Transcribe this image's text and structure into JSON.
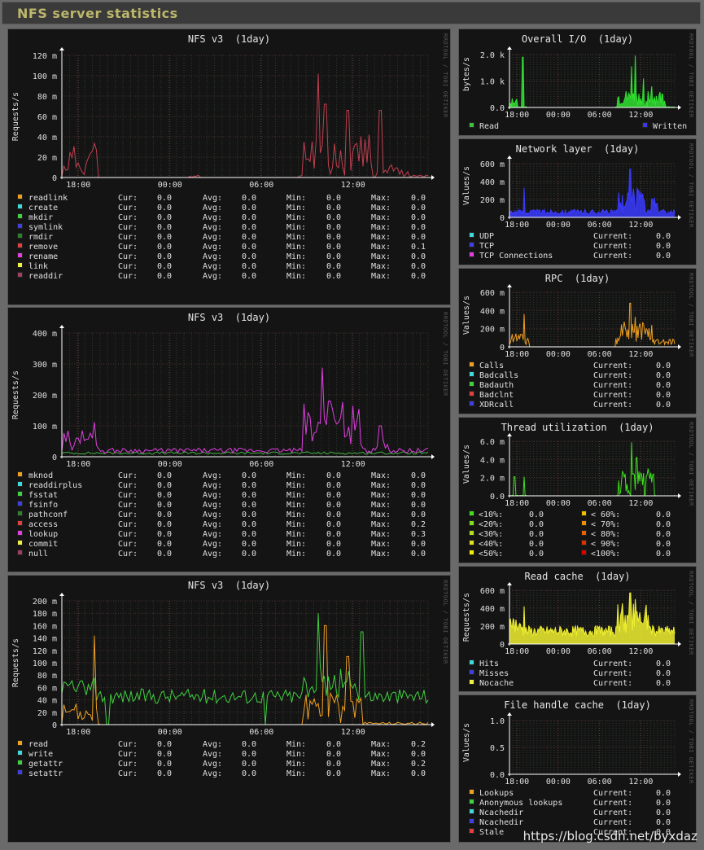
{
  "header": {
    "title": "NFS server statistics"
  },
  "watermark": "https://blog.csdn.net/byxdaz",
  "side_label": "RRDTOOL / TOBI OETIKER",
  "stat_labels": {
    "cur": "Cur:",
    "avg": "Avg:",
    "min": "Min:",
    "max": "Max:",
    "current": "Current:"
  },
  "panels": [
    {
      "id": "nfs1",
      "title": "NFS v3  (1day)",
      "ylabel": "Requests/s",
      "yticks": [
        "120 m",
        "100 m",
        "80 m",
        "60 m",
        "40 m",
        "20 m",
        "0"
      ],
      "xticks": [
        "18:00",
        "00:00",
        "06:00",
        "12:00"
      ],
      "legend": [
        {
          "name": "readlink",
          "color": "#f0a020",
          "cur": "0.0",
          "avg": "0.0",
          "min": "0.0",
          "max": "0.0"
        },
        {
          "name": "create",
          "color": "#40d8d8",
          "cur": "0.0",
          "avg": "0.0",
          "min": "0.0",
          "max": "0.0"
        },
        {
          "name": "mkdir",
          "color": "#40d040",
          "cur": "0.0",
          "avg": "0.0",
          "min": "0.0",
          "max": "0.0"
        },
        {
          "name": "symlink",
          "color": "#4040e0",
          "cur": "0.0",
          "avg": "0.0",
          "min": "0.0",
          "max": "0.0"
        },
        {
          "name": "rmdir",
          "color": "#308030",
          "cur": "0.0",
          "avg": "0.0",
          "min": "0.0",
          "max": "0.0"
        },
        {
          "name": "remove",
          "color": "#e04040",
          "cur": "0.0",
          "avg": "0.0",
          "min": "0.0",
          "max": "0.1"
        },
        {
          "name": "rename",
          "color": "#e040e0",
          "cur": "0.0",
          "avg": "0.0",
          "min": "0.0",
          "max": "0.0"
        },
        {
          "name": "link",
          "color": "#f0f040",
          "cur": "0.0",
          "avg": "0.0",
          "min": "0.0",
          "max": "0.0"
        },
        {
          "name": "readdir",
          "color": "#a04060",
          "cur": "0.0",
          "avg": "0.0",
          "min": "0.0",
          "max": "0.0"
        }
      ]
    },
    {
      "id": "nfs2",
      "title": "NFS v3  (1day)",
      "ylabel": "Requests/s",
      "yticks": [
        "400 m",
        "300 m",
        "200 m",
        "100 m",
        "0"
      ],
      "xticks": [
        "18:00",
        "00:00",
        "06:00",
        "12:00"
      ],
      "legend": [
        {
          "name": "mknod",
          "color": "#f0a020",
          "cur": "0.0",
          "avg": "0.0",
          "min": "0.0",
          "max": "0.0"
        },
        {
          "name": "readdirplus",
          "color": "#40d8d8",
          "cur": "0.0",
          "avg": "0.0",
          "min": "0.0",
          "max": "0.0"
        },
        {
          "name": "fsstat",
          "color": "#40d040",
          "cur": "0.0",
          "avg": "0.0",
          "min": "0.0",
          "max": "0.0"
        },
        {
          "name": "fsinfo",
          "color": "#4040e0",
          "cur": "0.0",
          "avg": "0.0",
          "min": "0.0",
          "max": "0.0"
        },
        {
          "name": "pathconf",
          "color": "#308030",
          "cur": "0.0",
          "avg": "0.0",
          "min": "0.0",
          "max": "0.0"
        },
        {
          "name": "access",
          "color": "#e04040",
          "cur": "0.0",
          "avg": "0.0",
          "min": "0.0",
          "max": "0.2"
        },
        {
          "name": "lookup",
          "color": "#e040e0",
          "cur": "0.0",
          "avg": "0.0",
          "min": "0.0",
          "max": "0.3"
        },
        {
          "name": "commit",
          "color": "#f0f040",
          "cur": "0.0",
          "avg": "0.0",
          "min": "0.0",
          "max": "0.0"
        },
        {
          "name": "null",
          "color": "#a04060",
          "cur": "0.0",
          "avg": "0.0",
          "min": "0.0",
          "max": "0.0"
        }
      ]
    },
    {
      "id": "nfs3",
      "title": "NFS v3  (1day)",
      "ylabel": "Requests/s",
      "yticks": [
        "200 m",
        "180 m",
        "160 m",
        "140 m",
        "120 m",
        "100 m",
        "80 m",
        "60 m",
        "40 m",
        "20 m",
        "0"
      ],
      "xticks": [
        "18:00",
        "00:00",
        "06:00",
        "12:00"
      ],
      "legend": [
        {
          "name": "read",
          "color": "#f0a020",
          "cur": "0.0",
          "avg": "0.0",
          "min": "0.0",
          "max": "0.2"
        },
        {
          "name": "write",
          "color": "#40d8d8",
          "cur": "0.0",
          "avg": "0.0",
          "min": "0.0",
          "max": "0.0"
        },
        {
          "name": "getattr",
          "color": "#40d040",
          "cur": "0.0",
          "avg": "0.0",
          "min": "0.0",
          "max": "0.2"
        },
        {
          "name": "setattr",
          "color": "#4040e0",
          "cur": "0.0",
          "avg": "0.0",
          "min": "0.0",
          "max": "0.0"
        }
      ]
    },
    {
      "id": "io",
      "title": "Overall I/O  (1day)",
      "ylabel": "bytes/s",
      "yticks": [
        "2.0 k",
        "1.0 k",
        "0.0"
      ],
      "xticks": [
        "18:00",
        "00:00",
        "06:00",
        "12:00"
      ],
      "legend_pair": [
        {
          "name": "Read",
          "color": "#40c040"
        },
        {
          "name": "Written",
          "color": "#3a3ae0"
        }
      ]
    },
    {
      "id": "net",
      "title": "Network layer  (1day)",
      "ylabel": "Values/s",
      "yticks": [
        "600 m",
        "400 m",
        "200 m",
        "0"
      ],
      "xticks": [
        "18:00",
        "00:00",
        "06:00",
        "12:00"
      ],
      "legend": [
        {
          "name": "UDP",
          "color": "#40d8d8",
          "current": "0.0"
        },
        {
          "name": "TCP",
          "color": "#4040e0",
          "current": "0.0"
        },
        {
          "name": "TCP Connections",
          "color": "#e040e0",
          "current": "0.0"
        }
      ]
    },
    {
      "id": "rpc",
      "title": "RPC  (1day)",
      "ylabel": "Values/s",
      "yticks": [
        "600 m",
        "400 m",
        "200 m",
        "0"
      ],
      "xticks": [
        "18:00",
        "00:00",
        "06:00",
        "12:00"
      ],
      "legend": [
        {
          "name": "Calls",
          "color": "#f0a020",
          "current": "0.0"
        },
        {
          "name": "Badcalls",
          "color": "#40d8d8",
          "current": "0.0"
        },
        {
          "name": "Badauth",
          "color": "#40d040",
          "current": "0.0"
        },
        {
          "name": "Badclnt",
          "color": "#e04040",
          "current": "0.0"
        },
        {
          "name": "XDRcall",
          "color": "#4040e0",
          "current": "0.0"
        }
      ]
    },
    {
      "id": "thr",
      "title": "Thread utilization  (1day)",
      "ylabel": "Values/s",
      "yticks": [
        "6.0 m",
        "4.0 m",
        "2.0 m",
        "0.0"
      ],
      "xticks": [
        "18:00",
        "00:00",
        "06:00",
        "12:00"
      ],
      "legend_grid": [
        [
          {
            "name": "<10%:",
            "color": "#40e020",
            "val": "0.0"
          },
          {
            "name": "< 60%:",
            "color": "#f0c000",
            "val": "0.0"
          }
        ],
        [
          {
            "name": "<20%:",
            "color": "#80e020",
            "val": "0.0"
          },
          {
            "name": "< 70%:",
            "color": "#f09000",
            "val": "0.0"
          }
        ],
        [
          {
            "name": "<30%:",
            "color": "#b0e020",
            "val": "0.0"
          },
          {
            "name": "< 80%:",
            "color": "#f06000",
            "val": "0.0"
          }
        ],
        [
          {
            "name": "<40%:",
            "color": "#e0e020",
            "val": "0.0"
          },
          {
            "name": "< 90%:",
            "color": "#e03000",
            "val": "0.0"
          }
        ],
        [
          {
            "name": "<50%:",
            "color": "#f0f000",
            "val": "0.0"
          },
          {
            "name": "<100%:",
            "color": "#e00000",
            "val": "0.0"
          }
        ]
      ]
    },
    {
      "id": "rc",
      "title": "Read cache  (1day)",
      "ylabel": "Requests/s",
      "yticks": [
        "600 m",
        "400 m",
        "200 m",
        "0"
      ],
      "xticks": [
        "18:00",
        "00:00",
        "06:00",
        "12:00"
      ],
      "legend": [
        {
          "name": "Hits",
          "color": "#40d8d8",
          "current": "0.0"
        },
        {
          "name": "Misses",
          "color": "#4040e0",
          "current": "0.0"
        },
        {
          "name": "Nocache",
          "color": "#f0f040",
          "current": "0.0"
        }
      ]
    },
    {
      "id": "fh",
      "title": "File handle cache  (1day)",
      "ylabel": "Values/s",
      "yticks": [
        "1.0",
        "0.5",
        "0.0"
      ],
      "xticks": [
        "18:00",
        "00:00",
        "06:00",
        "12:00"
      ],
      "legend": [
        {
          "name": "Lookups",
          "color": "#f0a020",
          "current": "0.0"
        },
        {
          "name": "Anonymous lookups",
          "color": "#40d040",
          "current": "0.0"
        },
        {
          "name": "Ncachedir",
          "color": "#40d8d8",
          "current": "0.0"
        },
        {
          "name": "Ncachedir",
          "color": "#4040e0",
          "current": "0.0"
        },
        {
          "name": "Stale",
          "color": "#e04040",
          "current": "0.0"
        }
      ]
    }
  ]
}
